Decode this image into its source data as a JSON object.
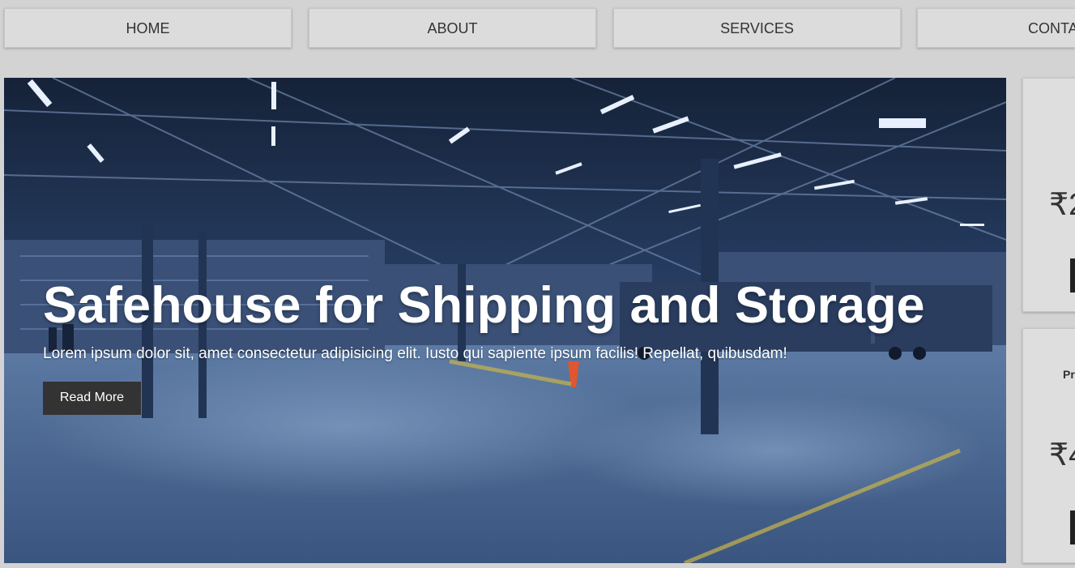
{
  "nav": {
    "items": [
      {
        "label": "HOME"
      },
      {
        "label": "ABOUT"
      },
      {
        "label": "SERVICES"
      },
      {
        "label": "CONTA"
      }
    ]
  },
  "hero": {
    "title": "Safehouse for Shipping and Storage",
    "text": "Lorem ipsum dolor sit, amet consectetur adipisicing elit. Iusto qui sapiente ipsum facilis! Repellat, quibusdam!",
    "button_label": "Read More"
  },
  "pricing_cards": [
    {
      "subtitle": "",
      "price": "₹2"
    },
    {
      "subtitle": "Pr",
      "price": "₹4"
    }
  ],
  "colors": {
    "page_bg": "#d3d3d3",
    "nav_bg": "#dcdcdc",
    "button_bg": "#333333",
    "hero_tint": "#2b4470"
  }
}
